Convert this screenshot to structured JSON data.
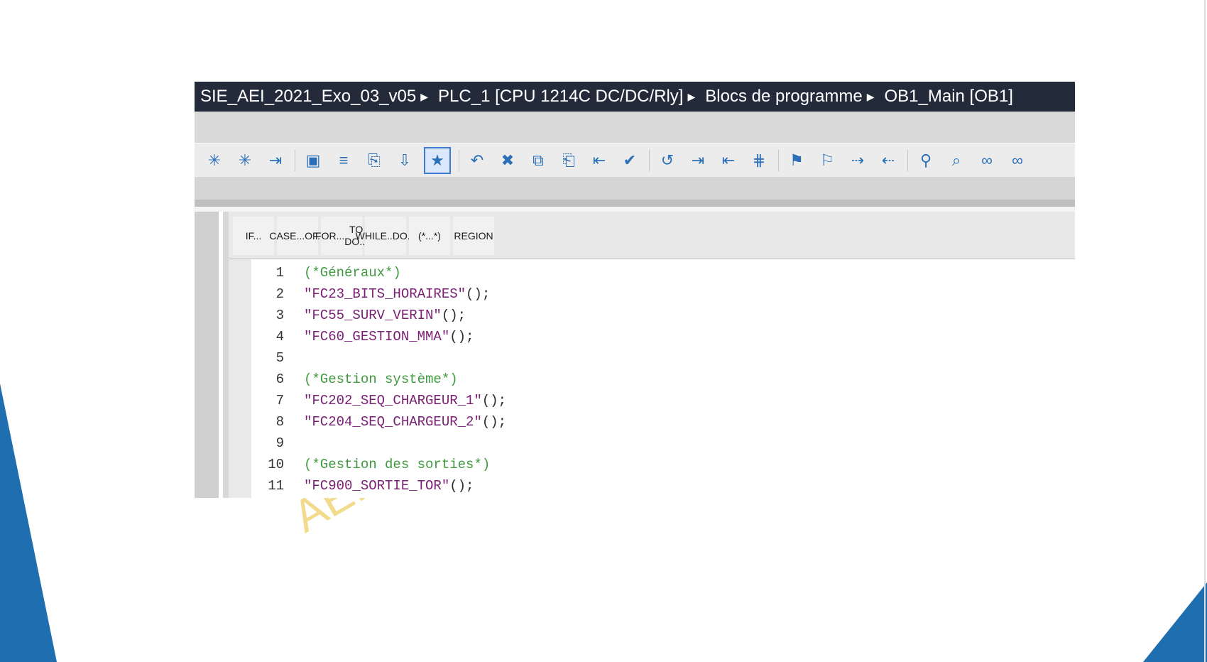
{
  "breadcrumb": {
    "project": "SIE_AEI_2021_Exo_03_v05",
    "plc": "PLC_1 [CPU 1214C DC/DC/Rly]",
    "folder": "Blocs de programme",
    "block": "OB1_Main [OB1]"
  },
  "toolbar_icons": [
    "insert-network-icon",
    "delete-network-icon",
    "download-icon",
    "monitor-icon",
    "list-icon",
    "compile-icon",
    "download-to-device-icon",
    "favorite-icon",
    "undo-delete-icon",
    "delete-icon",
    "copy-icon",
    "paste-icon",
    "indent-icon",
    "check-icon",
    "go-back-icon",
    "indent-right-icon",
    "indent-left-icon",
    "align-icon",
    "bookmark-icon",
    "clear-bookmark-icon",
    "next-bookmark-icon",
    "prev-bookmark-icon",
    "goto-icon",
    "search-icon",
    "glasses-icon",
    "glasses-step-icon"
  ],
  "snippets": [
    {
      "l1": "IF...",
      "l2": ""
    },
    {
      "l1": "CASE...",
      "l2": "OF..."
    },
    {
      "l1": "FOR...",
      "l2": "TO DO..."
    },
    {
      "l1": "WHILE..",
      "l2": "DO..."
    },
    {
      "l1": "(*...*)",
      "l2": ""
    },
    {
      "l1": "REGION",
      "l2": ""
    }
  ],
  "code": [
    {
      "n": "1",
      "text": "(*Généraux*)",
      "kind": "comment"
    },
    {
      "n": "2",
      "text": "\"FC23_BITS_HORAIRES\"",
      "tail": "();",
      "kind": "call"
    },
    {
      "n": "3",
      "text": "\"FC55_SURV_VERIN\"",
      "tail": "();",
      "kind": "call"
    },
    {
      "n": "4",
      "text": "\"FC60_GESTION_MMA\"",
      "tail": "();",
      "kind": "call"
    },
    {
      "n": "5",
      "text": "",
      "kind": "blank"
    },
    {
      "n": "6",
      "text": "(*Gestion système*)",
      "kind": "comment"
    },
    {
      "n": "7",
      "text": "\"FC202_SEQ_CHARGEUR_1\"",
      "tail": "();",
      "kind": "call"
    },
    {
      "n": "8",
      "text": "\"FC204_SEQ_CHARGEUR_2\"",
      "tail": "();",
      "kind": "call"
    },
    {
      "n": "9",
      "text": "",
      "kind": "blank"
    },
    {
      "n": "10",
      "text": "(*Gestion des sorties*)",
      "kind": "comment"
    },
    {
      "n": "11",
      "text": "\"FC900_SORTIE_TOR\"",
      "tail": "();",
      "kind": "call"
    }
  ],
  "watermark": "AEI",
  "colors": {
    "accent": "#1f6fb0",
    "comment": "#3f9a3f",
    "call": "#7a1e74",
    "titlebar": "#232b3b"
  }
}
